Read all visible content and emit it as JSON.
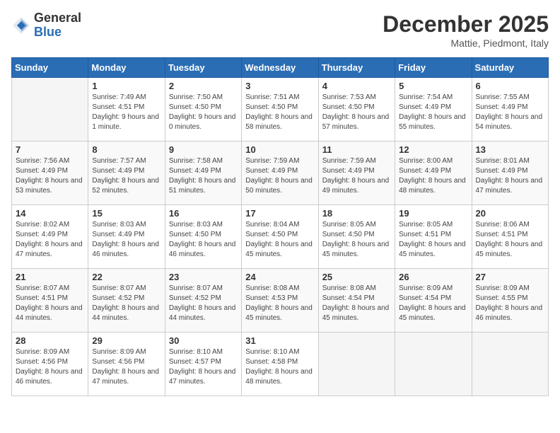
{
  "logo": {
    "general": "General",
    "blue": "Blue"
  },
  "title": "December 2025",
  "location": "Mattie, Piedmont, Italy",
  "days_of_week": [
    "Sunday",
    "Monday",
    "Tuesday",
    "Wednesday",
    "Thursday",
    "Friday",
    "Saturday"
  ],
  "weeks": [
    [
      {
        "day": "",
        "sunrise": "",
        "sunset": "",
        "daylight": ""
      },
      {
        "day": "1",
        "sunrise": "Sunrise: 7:49 AM",
        "sunset": "Sunset: 4:51 PM",
        "daylight": "Daylight: 9 hours and 1 minute."
      },
      {
        "day": "2",
        "sunrise": "Sunrise: 7:50 AM",
        "sunset": "Sunset: 4:50 PM",
        "daylight": "Daylight: 9 hours and 0 minutes."
      },
      {
        "day": "3",
        "sunrise": "Sunrise: 7:51 AM",
        "sunset": "Sunset: 4:50 PM",
        "daylight": "Daylight: 8 hours and 58 minutes."
      },
      {
        "day": "4",
        "sunrise": "Sunrise: 7:53 AM",
        "sunset": "Sunset: 4:50 PM",
        "daylight": "Daylight: 8 hours and 57 minutes."
      },
      {
        "day": "5",
        "sunrise": "Sunrise: 7:54 AM",
        "sunset": "Sunset: 4:49 PM",
        "daylight": "Daylight: 8 hours and 55 minutes."
      },
      {
        "day": "6",
        "sunrise": "Sunrise: 7:55 AM",
        "sunset": "Sunset: 4:49 PM",
        "daylight": "Daylight: 8 hours and 54 minutes."
      }
    ],
    [
      {
        "day": "7",
        "sunrise": "Sunrise: 7:56 AM",
        "sunset": "Sunset: 4:49 PM",
        "daylight": "Daylight: 8 hours and 53 minutes."
      },
      {
        "day": "8",
        "sunrise": "Sunrise: 7:57 AM",
        "sunset": "Sunset: 4:49 PM",
        "daylight": "Daylight: 8 hours and 52 minutes."
      },
      {
        "day": "9",
        "sunrise": "Sunrise: 7:58 AM",
        "sunset": "Sunset: 4:49 PM",
        "daylight": "Daylight: 8 hours and 51 minutes."
      },
      {
        "day": "10",
        "sunrise": "Sunrise: 7:59 AM",
        "sunset": "Sunset: 4:49 PM",
        "daylight": "Daylight: 8 hours and 50 minutes."
      },
      {
        "day": "11",
        "sunrise": "Sunrise: 7:59 AM",
        "sunset": "Sunset: 4:49 PM",
        "daylight": "Daylight: 8 hours and 49 minutes."
      },
      {
        "day": "12",
        "sunrise": "Sunrise: 8:00 AM",
        "sunset": "Sunset: 4:49 PM",
        "daylight": "Daylight: 8 hours and 48 minutes."
      },
      {
        "day": "13",
        "sunrise": "Sunrise: 8:01 AM",
        "sunset": "Sunset: 4:49 PM",
        "daylight": "Daylight: 8 hours and 47 minutes."
      }
    ],
    [
      {
        "day": "14",
        "sunrise": "Sunrise: 8:02 AM",
        "sunset": "Sunset: 4:49 PM",
        "daylight": "Daylight: 8 hours and 47 minutes."
      },
      {
        "day": "15",
        "sunrise": "Sunrise: 8:03 AM",
        "sunset": "Sunset: 4:49 PM",
        "daylight": "Daylight: 8 hours and 46 minutes."
      },
      {
        "day": "16",
        "sunrise": "Sunrise: 8:03 AM",
        "sunset": "Sunset: 4:50 PM",
        "daylight": "Daylight: 8 hours and 46 minutes."
      },
      {
        "day": "17",
        "sunrise": "Sunrise: 8:04 AM",
        "sunset": "Sunset: 4:50 PM",
        "daylight": "Daylight: 8 hours and 45 minutes."
      },
      {
        "day": "18",
        "sunrise": "Sunrise: 8:05 AM",
        "sunset": "Sunset: 4:50 PM",
        "daylight": "Daylight: 8 hours and 45 minutes."
      },
      {
        "day": "19",
        "sunrise": "Sunrise: 8:05 AM",
        "sunset": "Sunset: 4:51 PM",
        "daylight": "Daylight: 8 hours and 45 minutes."
      },
      {
        "day": "20",
        "sunrise": "Sunrise: 8:06 AM",
        "sunset": "Sunset: 4:51 PM",
        "daylight": "Daylight: 8 hours and 45 minutes."
      }
    ],
    [
      {
        "day": "21",
        "sunrise": "Sunrise: 8:07 AM",
        "sunset": "Sunset: 4:51 PM",
        "daylight": "Daylight: 8 hours and 44 minutes."
      },
      {
        "day": "22",
        "sunrise": "Sunrise: 8:07 AM",
        "sunset": "Sunset: 4:52 PM",
        "daylight": "Daylight: 8 hours and 44 minutes."
      },
      {
        "day": "23",
        "sunrise": "Sunrise: 8:07 AM",
        "sunset": "Sunset: 4:52 PM",
        "daylight": "Daylight: 8 hours and 44 minutes."
      },
      {
        "day": "24",
        "sunrise": "Sunrise: 8:08 AM",
        "sunset": "Sunset: 4:53 PM",
        "daylight": "Daylight: 8 hours and 45 minutes."
      },
      {
        "day": "25",
        "sunrise": "Sunrise: 8:08 AM",
        "sunset": "Sunset: 4:54 PM",
        "daylight": "Daylight: 8 hours and 45 minutes."
      },
      {
        "day": "26",
        "sunrise": "Sunrise: 8:09 AM",
        "sunset": "Sunset: 4:54 PM",
        "daylight": "Daylight: 8 hours and 45 minutes."
      },
      {
        "day": "27",
        "sunrise": "Sunrise: 8:09 AM",
        "sunset": "Sunset: 4:55 PM",
        "daylight": "Daylight: 8 hours and 46 minutes."
      }
    ],
    [
      {
        "day": "28",
        "sunrise": "Sunrise: 8:09 AM",
        "sunset": "Sunset: 4:56 PM",
        "daylight": "Daylight: 8 hours and 46 minutes."
      },
      {
        "day": "29",
        "sunrise": "Sunrise: 8:09 AM",
        "sunset": "Sunset: 4:56 PM",
        "daylight": "Daylight: 8 hours and 47 minutes."
      },
      {
        "day": "30",
        "sunrise": "Sunrise: 8:10 AM",
        "sunset": "Sunset: 4:57 PM",
        "daylight": "Daylight: 8 hours and 47 minutes."
      },
      {
        "day": "31",
        "sunrise": "Sunrise: 8:10 AM",
        "sunset": "Sunset: 4:58 PM",
        "daylight": "Daylight: 8 hours and 48 minutes."
      },
      {
        "day": "",
        "sunrise": "",
        "sunset": "",
        "daylight": ""
      },
      {
        "day": "",
        "sunrise": "",
        "sunset": "",
        "daylight": ""
      },
      {
        "day": "",
        "sunrise": "",
        "sunset": "",
        "daylight": ""
      }
    ]
  ]
}
